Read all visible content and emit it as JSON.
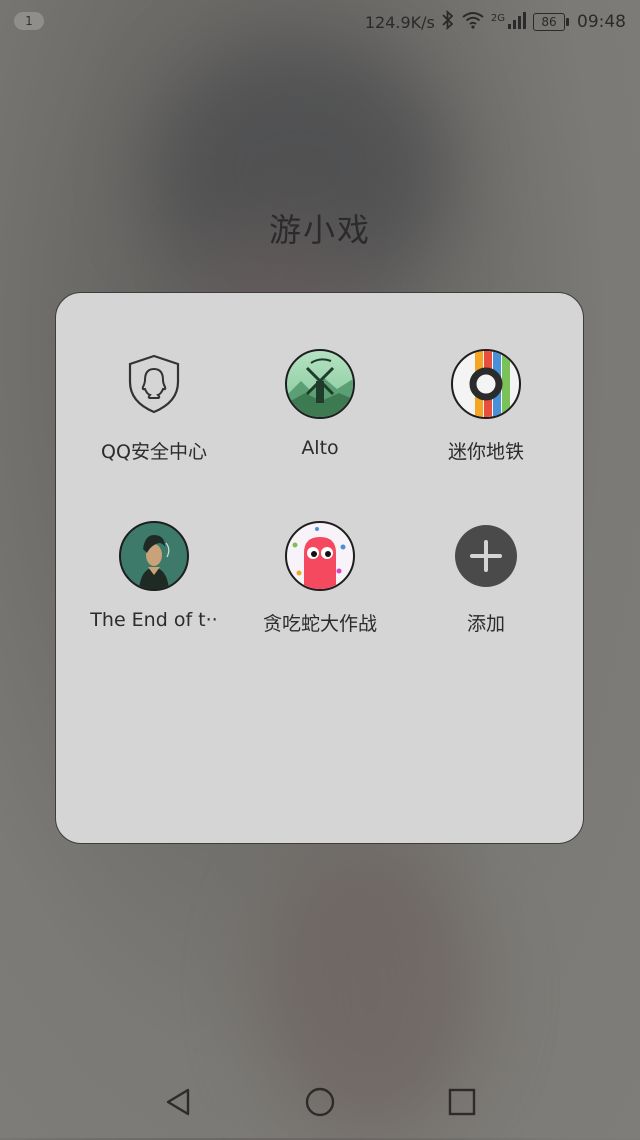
{
  "status_bar": {
    "notification_count": "1",
    "net_speed": "124.9K/s",
    "network_type": "2G",
    "battery": "86",
    "time": "09:48",
    "icons": [
      "bluetooth-icon",
      "wifi-icon",
      "signal-icon",
      "battery-icon"
    ]
  },
  "folder": {
    "title": "游小戏",
    "apps": [
      {
        "label": "QQ安全中心",
        "icon": "qq-security-shield-icon"
      },
      {
        "label": "Alto",
        "icon": "alto-windmill-icon"
      },
      {
        "label": "迷你地铁",
        "icon": "mini-metro-icon"
      },
      {
        "label": "The End of t··",
        "icon": "end-of-the-world-icon"
      },
      {
        "label": "贪吃蛇大作战",
        "icon": "snake-game-icon"
      },
      {
        "label": "添加",
        "icon": "add-icon"
      }
    ]
  },
  "nav_bar": {
    "buttons": [
      "back-icon",
      "home-icon",
      "recents-icon"
    ]
  }
}
